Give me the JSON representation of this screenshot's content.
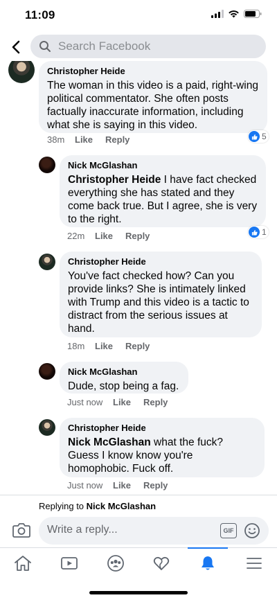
{
  "status_bar": {
    "time": "11:09"
  },
  "search": {
    "placeholder": "Search Facebook"
  },
  "comments": [
    {
      "author": "Christopher Heide",
      "text": "The woman in this video is a paid, right-wing political commentator. She often posts factually inaccurate information, including what she is saying in this video.",
      "time": "38m",
      "like_label": "Like",
      "reply_label": "Reply",
      "reactions": "5"
    },
    {
      "author": "Nick McGlashan",
      "mention": "Christopher Heide",
      "text": " I have fact checked everything she has stated and they come back true. But I agree, she is very to the right.",
      "time": "22m",
      "like_label": "Like",
      "reply_label": "Reply",
      "reactions": "1"
    },
    {
      "author": "Christopher Heide",
      "text": "You've fact checked how? Can you provide links? She is intimately linked with Trump and this video is a tactic to distract from the serious issues at hand.",
      "time": "18m",
      "like_label": "Like",
      "reply_label": "Reply"
    },
    {
      "author": "Nick McGlashan",
      "text": "Dude, stop being a fag.",
      "time": "Just now",
      "like_label": "Like",
      "reply_label": "Reply"
    },
    {
      "author": "Christopher Heide",
      "mention": "Nick McGlashan",
      "text": " what the fuck? Guess I know know you're homophobic. Fuck off.",
      "time": "Just now",
      "like_label": "Like",
      "reply_label": "Reply"
    }
  ],
  "replying": {
    "prefix": "Replying to ",
    "name": "Nick McGlashan"
  },
  "composer": {
    "placeholder": "Write a reply...",
    "gif_label": "GIF"
  },
  "tabs": [
    "home",
    "watch",
    "groups",
    "dating",
    "notifications",
    "menu"
  ],
  "colors": {
    "accent": "#1877f2",
    "bubble": "#f0f2f5",
    "secondary_text": "#65676b"
  }
}
